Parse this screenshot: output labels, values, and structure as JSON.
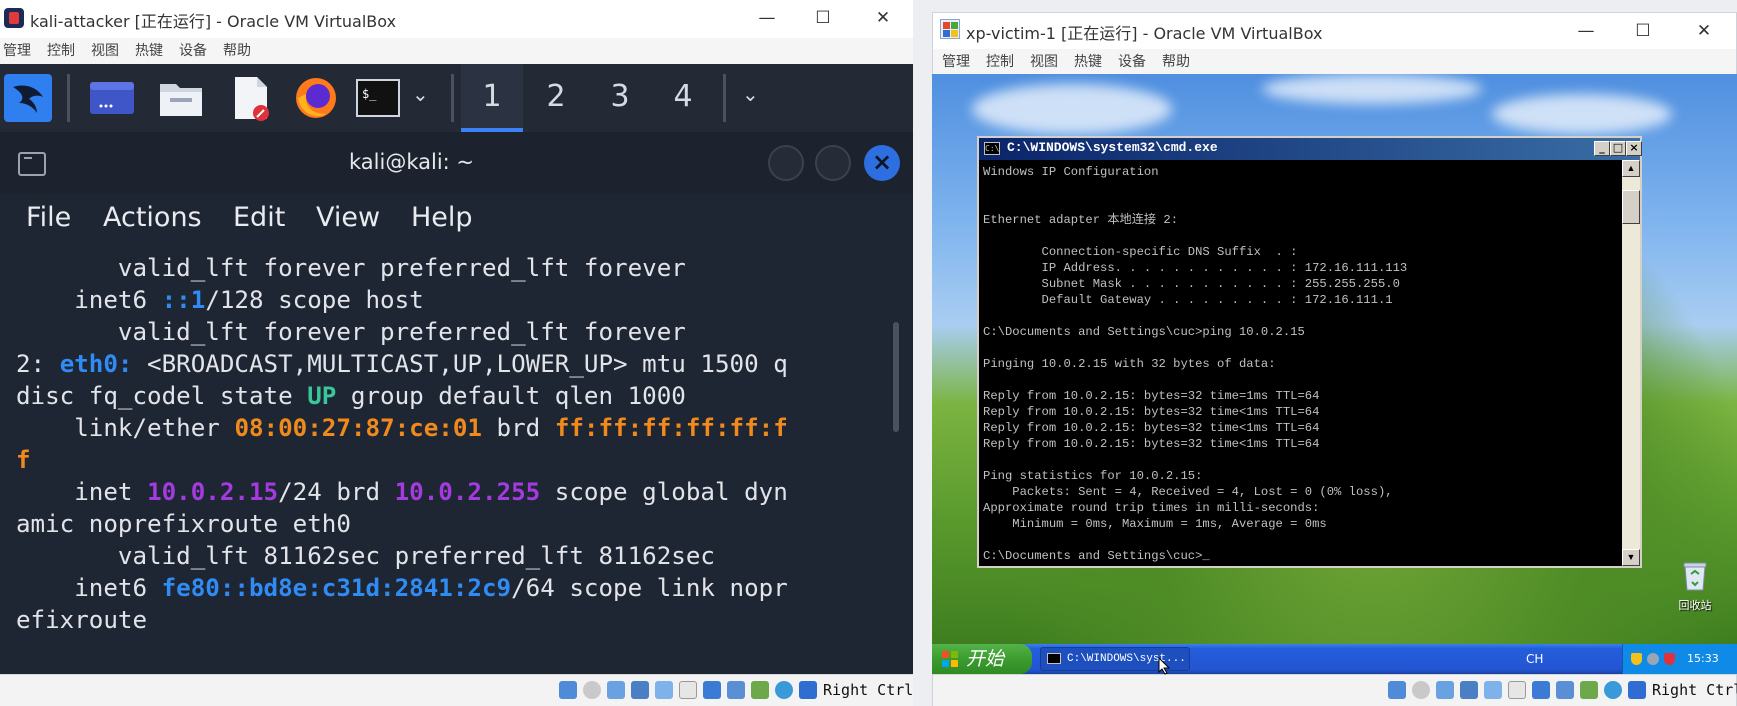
{
  "left_window": {
    "title": "kali-attacker [正在运行] - Oracle VM VirtualBox",
    "menu": [
      "管理",
      "控制",
      "视图",
      "热键",
      "设备",
      "帮助"
    ],
    "controls": {
      "minimize": "—",
      "maximize": "☐",
      "close": "✕"
    },
    "panel": {
      "apps": [
        "kali-menu-icon",
        "terminal-launcher-icon",
        "file-manager-icon",
        "text-editor-icon",
        "firefox-icon",
        "terminal-icon"
      ],
      "workspaces": [
        "1",
        "2",
        "3",
        "4"
      ],
      "active_workspace": "1"
    },
    "terminal": {
      "title": "kali@kali: ~",
      "menu": [
        "File",
        "Actions",
        "Edit",
        "View",
        "Help"
      ],
      "lines": [
        [
          {
            "t": "       valid_lft forever preferred_lft forever",
            "c": ""
          }
        ],
        [
          {
            "t": "    inet6 ",
            "c": ""
          },
          {
            "t": "::1",
            "c": "blue"
          },
          {
            "t": "/128 scope host",
            "c": ""
          }
        ],
        [
          {
            "t": "       valid_lft forever preferred_lft forever",
            "c": ""
          }
        ],
        [
          {
            "t": "2: ",
            "c": ""
          },
          {
            "t": "eth0:",
            "c": "blue"
          },
          {
            "t": " <BROADCAST,MULTICAST,UP,LOWER_UP> mtu 1500 q",
            "c": ""
          }
        ],
        [
          {
            "t": "disc fq_codel state ",
            "c": ""
          },
          {
            "t": "UP",
            "c": "green"
          },
          {
            "t": " group default qlen 1000",
            "c": ""
          }
        ],
        [
          {
            "t": "    link/ether ",
            "c": ""
          },
          {
            "t": "08:00:27:87:ce:01",
            "c": "orange"
          },
          {
            "t": " brd ",
            "c": ""
          },
          {
            "t": "ff:ff:ff:ff:ff:f",
            "c": "orange"
          }
        ],
        [
          {
            "t": "f",
            "c": "orange"
          }
        ],
        [
          {
            "t": "    inet ",
            "c": ""
          },
          {
            "t": "10.0.2.15",
            "c": "purple"
          },
          {
            "t": "/24 brd ",
            "c": ""
          },
          {
            "t": "10.0.2.255",
            "c": "purple"
          },
          {
            "t": " scope global dyn",
            "c": ""
          }
        ],
        [
          {
            "t": "amic noprefixroute eth0",
            "c": ""
          }
        ],
        [
          {
            "t": "       valid_lft 81162sec preferred_lft 81162sec",
            "c": ""
          }
        ],
        [
          {
            "t": "    inet6 ",
            "c": ""
          },
          {
            "t": "fe80::bd8e:c31d:2841:2c9",
            "c": "blue"
          },
          {
            "t": "/64 scope link nopr",
            "c": ""
          }
        ],
        [
          {
            "t": "efixroute",
            "c": ""
          }
        ]
      ]
    },
    "status_right_ctrl": "Right Ctrl"
  },
  "right_window": {
    "title": "xp-victim-1 [正在运行] - Oracle VM VirtualBox",
    "menu": [
      "管理",
      "控制",
      "视图",
      "热键",
      "设备",
      "帮助"
    ],
    "controls": {
      "minimize": "—",
      "maximize": "☐",
      "close": "✕"
    },
    "cmd": {
      "title": "C:\\WINDOWS\\system32\\cmd.exe",
      "lines": [
        "Windows IP Configuration",
        "",
        "",
        "Ethernet adapter 本地连接 2:",
        "",
        "        Connection-specific DNS Suffix  . :",
        "        IP Address. . . . . . . . . . . . : 172.16.111.113",
        "        Subnet Mask . . . . . . . . . . . : 255.255.255.0",
        "        Default Gateway . . . . . . . . . : 172.16.111.1",
        "",
        "C:\\Documents and Settings\\cuc>ping 10.0.2.15",
        "",
        "Pinging 10.0.2.15 with 32 bytes of data:",
        "",
        "Reply from 10.0.2.15: bytes=32 time=1ms TTL=64",
        "Reply from 10.0.2.15: bytes=32 time<1ms TTL=64",
        "Reply from 10.0.2.15: bytes=32 time<1ms TTL=64",
        "Reply from 10.0.2.15: bytes=32 time<1ms TTL=64",
        "",
        "Ping statistics for 10.0.2.15:",
        "    Packets: Sent = 4, Received = 4, Lost = 0 (0% loss),",
        "Approximate round trip times in milli-seconds:",
        "    Minimum = 0ms, Maximum = 1ms, Average = 0ms",
        "",
        "C:\\Documents and Settings\\cuc>_"
      ]
    },
    "desktop": {
      "recycle_bin_label": "回收站"
    },
    "taskbar": {
      "start_label": "开始",
      "task_label": "C:\\WINDOWS\\syst...",
      "lang": "CH",
      "clock": "15:33"
    },
    "status_right_ctrl": "Right Ctrl"
  }
}
